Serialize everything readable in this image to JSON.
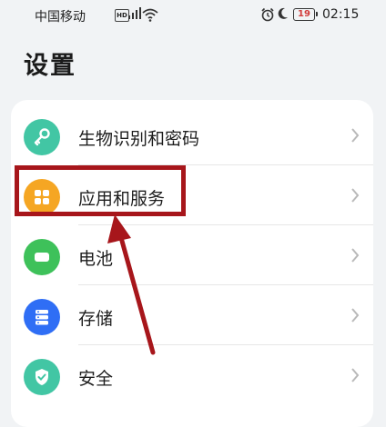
{
  "status_bar": {
    "carrier": "中国移动",
    "hd": "HD",
    "battery": "19",
    "time": "02:15"
  },
  "page": {
    "title": "设置"
  },
  "menu": {
    "items": [
      {
        "label": "生物识别和密码",
        "icon": "key-icon",
        "color": "#42c6a4"
      },
      {
        "label": "应用和服务",
        "icon": "apps-grid-icon",
        "color": "#f5a623"
      },
      {
        "label": "电池",
        "icon": "battery-icon",
        "color": "#3ec15a"
      },
      {
        "label": "存储",
        "icon": "storage-icon",
        "color": "#2f6ef5"
      },
      {
        "label": "安全",
        "icon": "shield-icon",
        "color": "#42c6a4"
      }
    ]
  },
  "annotation": {
    "highlight_color": "#a7161b"
  }
}
